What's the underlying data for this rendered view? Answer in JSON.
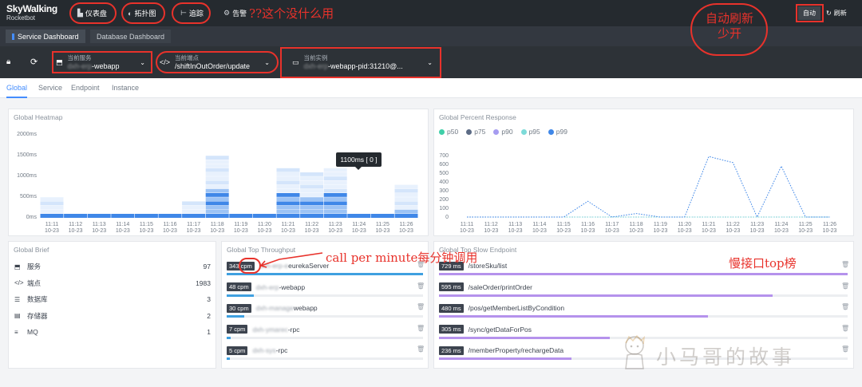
{
  "logo": {
    "title": "SkyWalking",
    "subtitle": "Rocketbot"
  },
  "nav": {
    "dashboard": "仪表盘",
    "topology": "拓扑图",
    "trace": "追踪",
    "alarm": "告警"
  },
  "header_right": {
    "auto": "自动",
    "refresh": "刷新"
  },
  "dash_tabs": [
    "Service Dashboard",
    "Database Dashboard"
  ],
  "selectors": {
    "service": {
      "label": "当前服务",
      "value_blur": "dxh-erp",
      "value": "-webapp"
    },
    "endpoint": {
      "label": "当前端点",
      "value": "/shiftInOutOrder/update"
    },
    "instance": {
      "label": "当前实例",
      "value_blur": "dxh-erp",
      "value": "-webapp-pid:31210@..."
    }
  },
  "page_tabs": [
    "Global",
    "Service",
    "Endpoint",
    "Instance"
  ],
  "panels": {
    "heatmap": "Global Heatmap",
    "percent": "Global Percent Response",
    "brief": "Global Brief",
    "throughput": "Global Top Throughput",
    "slow": "Global Top Slow Endpoint"
  },
  "tooltip": "1100ms [ 0 ]",
  "brief": [
    {
      "icon": "cube-icon",
      "label": "服务",
      "value": "97"
    },
    {
      "icon": "code-icon",
      "label": "端点",
      "value": "1983"
    },
    {
      "icon": "database-icon",
      "label": "数据库",
      "value": "3"
    },
    {
      "icon": "storage-icon",
      "label": "存储器",
      "value": "2"
    },
    {
      "icon": "list-icon",
      "label": "MQ",
      "value": "1"
    }
  ],
  "throughput": [
    {
      "cpm": "343 cpm",
      "blur": "dxh-erp-e",
      "name": "eurekaServer",
      "ratio": 1.0
    },
    {
      "cpm": "48 cpm",
      "blur": "dxh-erp",
      "name": "-webapp",
      "ratio": 0.14
    },
    {
      "cpm": "30 cpm",
      "blur": "dxh-manage",
      "name": "webapp",
      "ratio": 0.09
    },
    {
      "cpm": "7 cpm",
      "blur": "dxh-ymarec",
      "name": "-rpc",
      "ratio": 0.02
    },
    {
      "cpm": "5 cpm",
      "blur": "dxh-sys",
      "name": "-rpc",
      "ratio": 0.015
    }
  ],
  "slow": [
    {
      "ms": "729 ms",
      "name": "/storeSku/list",
      "ratio": 1.0
    },
    {
      "ms": "595 ms",
      "name": "/saleOrder/printOrder",
      "ratio": 0.816
    },
    {
      "ms": "480 ms",
      "name": "/pos/getMemberListByCondition",
      "ratio": 0.658
    },
    {
      "ms": "305 ms",
      "name": "/sync/getDataForPos",
      "ratio": 0.418
    },
    {
      "ms": "236 ms",
      "name": "/memberProperty/rechargeData",
      "ratio": 0.324
    }
  ],
  "annotations": {
    "unused": "??这个没什么用",
    "auto_refresh": "自动刷新\n少开",
    "cpm": "call per minute每分钟调用",
    "slow": "慢接口top榜"
  },
  "watermark": "小马哥的故事",
  "chart_data": [
    {
      "type": "heatmap",
      "title": "Global Heatmap",
      "x": [
        "11:11\n10-23",
        "11:12\n10-23",
        "11:13\n10-23",
        "11:14\n10-23",
        "11:15\n10-23",
        "11:16\n10-23",
        "11:17\n10-23",
        "11:18\n10-23",
        "11:19\n10-23",
        "11:20\n10-23",
        "11:21\n10-23",
        "11:22\n10-23",
        "11:23\n10-23",
        "11:24\n10-23",
        "11:25\n10-23",
        "11:26\n10-23"
      ],
      "y_ticks": [
        "0ms",
        "500ms",
        "1000ms",
        "1500ms",
        "2000ms"
      ],
      "ylim": [
        0,
        2000
      ],
      "column_top_ms": [
        400,
        0,
        0,
        0,
        0,
        0,
        300,
        1400,
        0,
        0,
        1100,
        1000,
        1100,
        0,
        0,
        700
      ],
      "colors": {
        "low": "#e8f1fd",
        "mid": "#9cc3f5",
        "high": "#3f87e8"
      }
    },
    {
      "type": "line",
      "title": "Global Percent Response",
      "x": [
        "11:11\n10-23",
        "11:12\n10-23",
        "11:13\n10-23",
        "11:14\n10-23",
        "11:15\n10-23",
        "11:16\n10-23",
        "11:17\n10-23",
        "11:18\n10-23",
        "11:19\n10-23",
        "11:20\n10-23",
        "11:21\n10-23",
        "11:22\n10-23",
        "11:23\n10-23",
        "11:24\n10-23",
        "11:25\n10-23",
        "11:26\n10-23"
      ],
      "y_ticks": [
        0,
        100,
        200,
        300,
        400,
        500,
        600,
        700
      ],
      "ylim": [
        0,
        700
      ],
      "series": [
        {
          "name": "p50",
          "color": "#3fcfa8",
          "values": [
            0,
            0,
            0,
            0,
            0,
            0,
            0,
            0,
            0,
            0,
            0,
            0,
            0,
            0,
            0,
            0
          ]
        },
        {
          "name": "p75",
          "color": "#5c6b85",
          "values": [
            0,
            0,
            0,
            0,
            0,
            0,
            0,
            0,
            0,
            0,
            0,
            0,
            0,
            0,
            0,
            0
          ]
        },
        {
          "name": "p90",
          "color": "#a69cf0",
          "values": [
            0,
            0,
            0,
            0,
            0,
            0,
            0,
            0,
            0,
            0,
            0,
            0,
            0,
            0,
            0,
            0
          ]
        },
        {
          "name": "p95",
          "color": "#7ddbd9",
          "values": [
            0,
            0,
            0,
            0,
            0,
            0,
            0,
            0,
            0,
            0,
            0,
            0,
            0,
            0,
            0,
            0
          ]
        },
        {
          "name": "p99",
          "color": "#3f87e8",
          "values": [
            0,
            0,
            0,
            0,
            0,
            180,
            0,
            40,
            0,
            0,
            690,
            620,
            0,
            580,
            0,
            0
          ]
        }
      ]
    }
  ]
}
